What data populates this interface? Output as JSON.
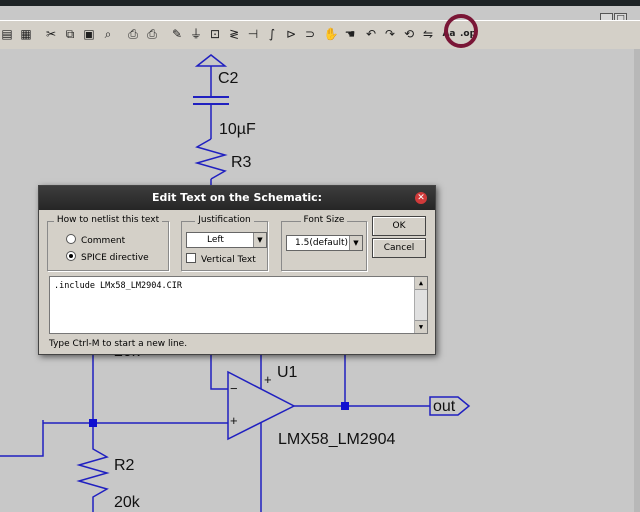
{
  "window": {
    "controls": [
      "_",
      "□",
      "×"
    ]
  },
  "toolbar": {
    "items": [
      {
        "name": "wire-window-icon",
        "glyph": "▤"
      },
      {
        "name": "multi-window-icon",
        "glyph": "▦"
      },
      {
        "name": "cut-icon",
        "glyph": "✂"
      },
      {
        "name": "copy-icon",
        "glyph": "⧉"
      },
      {
        "name": "paste-icon",
        "glyph": "▣"
      },
      {
        "name": "find-icon",
        "glyph": "⌕"
      },
      {
        "name": "print-setup-icon",
        "glyph": "⎙"
      },
      {
        "name": "print-icon",
        "glyph": "⎙"
      },
      {
        "name": "draw-wire-icon",
        "glyph": "✎"
      },
      {
        "name": "ground-icon",
        "glyph": "⏚"
      },
      {
        "name": "label-net-icon",
        "glyph": "⊡"
      },
      {
        "name": "resistor-icon",
        "glyph": "≷"
      },
      {
        "name": "capacitor-icon",
        "glyph": "⊣"
      },
      {
        "name": "inductor-icon",
        "glyph": "∫"
      },
      {
        "name": "diode-icon",
        "glyph": "⊳"
      },
      {
        "name": "component-icon",
        "glyph": "⊃"
      },
      {
        "name": "move-icon",
        "glyph": "✋"
      },
      {
        "name": "drag-icon",
        "glyph": "☚"
      },
      {
        "name": "undo-icon",
        "glyph": "↶"
      },
      {
        "name": "redo-icon",
        "glyph": "↷"
      },
      {
        "name": "rotate-icon",
        "glyph": "⟲"
      },
      {
        "name": "mirror-icon",
        "glyph": "⇋"
      },
      {
        "name": "text-icon",
        "glyph": "Aa"
      },
      {
        "name": "spice-directive-icon",
        "glyph": ".op"
      }
    ]
  },
  "schematic": {
    "c2_label": "C2",
    "c2_value": "10µF",
    "r3_label": "R3",
    "r_upper_value": "20k",
    "u1_label": "U1",
    "u1_value": "LMX58_LM2904",
    "plus_top": "+",
    "plus_bottom": "+",
    "minus": "−",
    "r2_label": "R2",
    "r2_value": "20k",
    "out_label": "out"
  },
  "dialog": {
    "title": "Edit Text on the Schematic:",
    "netlist_group": "How to netlist this text",
    "comment_label": "Comment",
    "spice_label": "SPICE directive",
    "justification_group": "Justification",
    "justification_value": "Left",
    "vertical_text_label": "Vertical Text",
    "font_size_group": "Font Size",
    "font_size_value": "1.5(default)",
    "ok_label": "OK",
    "cancel_label": "Cancel",
    "text_content": ".include LMx58_LM2904.CIR",
    "hint": "Type Ctrl-M to start a new line."
  },
  "colors": {
    "wire": "#2020c0",
    "node": "#1010d0",
    "highlight": "#7a1636"
  }
}
